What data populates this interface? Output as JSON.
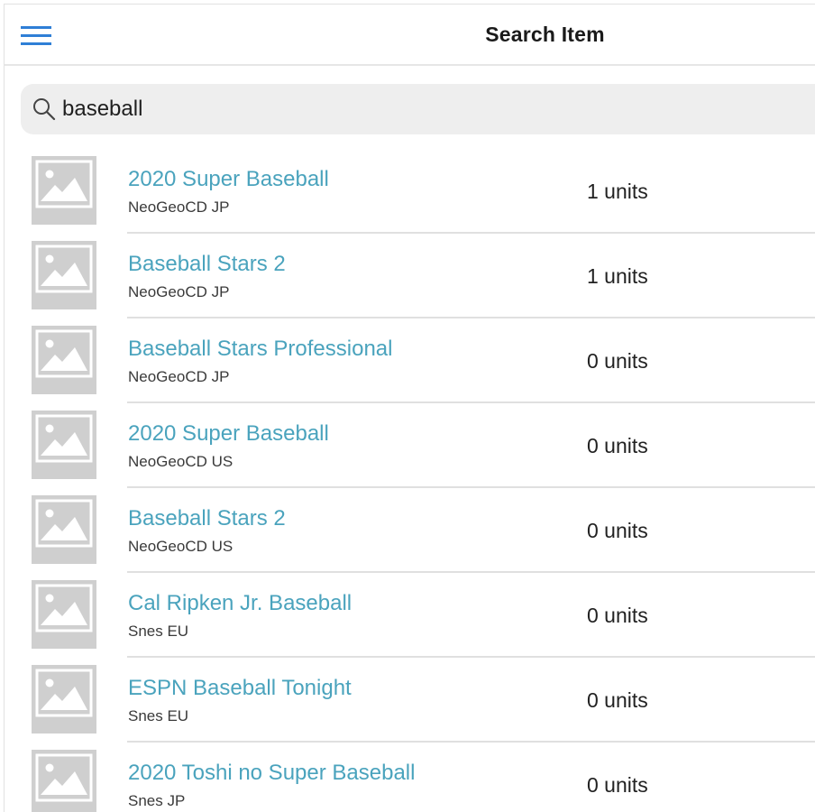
{
  "header": {
    "title": "Search Item",
    "menu_icon": "hamburger-menu-icon"
  },
  "search": {
    "icon": "search-icon",
    "value": "baseball",
    "placeholder": ""
  },
  "colors": {
    "accent": "#2f7fd6",
    "item_link": "#4aa3bd",
    "thumbnail": "#cfcfcf"
  },
  "results": [
    {
      "name": "2020 Super Baseball",
      "platform": "NeoGeoCD JP",
      "units": "1 units"
    },
    {
      "name": "Baseball Stars 2",
      "platform": "NeoGeoCD JP",
      "units": "1 units"
    },
    {
      "name": "Baseball Stars Professional",
      "platform": "NeoGeoCD JP",
      "units": "0 units"
    },
    {
      "name": "2020 Super Baseball",
      "platform": "NeoGeoCD US",
      "units": "0 units"
    },
    {
      "name": "Baseball Stars 2",
      "platform": "NeoGeoCD US",
      "units": "0 units"
    },
    {
      "name": "Cal Ripken Jr. Baseball",
      "platform": "Snes EU",
      "units": "0 units"
    },
    {
      "name": "ESPN Baseball Tonight",
      "platform": "Snes EU",
      "units": "0 units"
    },
    {
      "name": "2020 Toshi no Super Baseball",
      "platform": "Snes JP",
      "units": "0 units"
    }
  ]
}
